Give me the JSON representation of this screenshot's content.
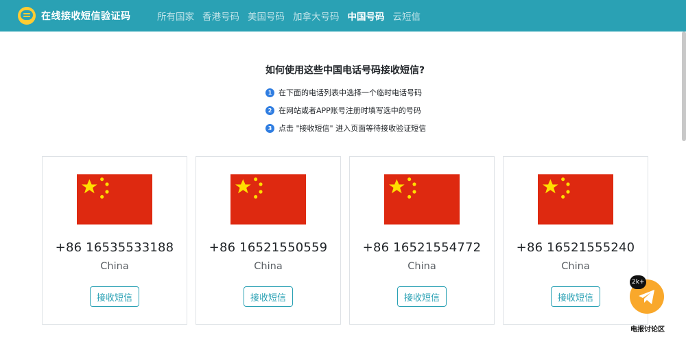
{
  "brand": {
    "title": "在线接收短信验证码",
    "icon": "chat-bubble-icon"
  },
  "nav": {
    "items": [
      {
        "label": "所有国家",
        "active": false
      },
      {
        "label": "香港号码",
        "active": false
      },
      {
        "label": "美国号码",
        "active": false
      },
      {
        "label": "加拿大号码",
        "active": false
      },
      {
        "label": "中国号码",
        "active": true
      },
      {
        "label": "云短信",
        "active": false
      }
    ]
  },
  "instructions": {
    "title": "如何使用这些中国电话号码接收短信?",
    "steps": [
      {
        "num": "1",
        "text": "在下面的电话列表中选择一个临时电话号码"
      },
      {
        "num": "2",
        "text": "在网站或者APP账号注册时填写选中的号码"
      },
      {
        "num": "3",
        "text": "点击 \"接收短信\" 进入页面等待接收验证短信"
      }
    ]
  },
  "cards": [
    {
      "phone": "+86 16535533188",
      "country": "China",
      "button": "接收短信",
      "flag": "china-flag-icon"
    },
    {
      "phone": "+86 16521550559",
      "country": "China",
      "button": "接收短信",
      "flag": "china-flag-icon"
    },
    {
      "phone": "+86 16521554772",
      "country": "China",
      "button": "接收短信",
      "flag": "china-flag-icon"
    },
    {
      "phone": "+86 16521555240",
      "country": "China",
      "button": "接收短信",
      "flag": "china-flag-icon"
    }
  ],
  "telegram": {
    "badge": "2k+",
    "label": "电报讨论区",
    "icon": "telegram-icon"
  },
  "colors": {
    "navbar": "#2aa1b4",
    "brand_icon": "#ffcc33",
    "step_badge": "#2f7de1",
    "flag_red": "#de2910",
    "flag_star": "#ffde00",
    "telegram_button": "#f9a82b"
  }
}
